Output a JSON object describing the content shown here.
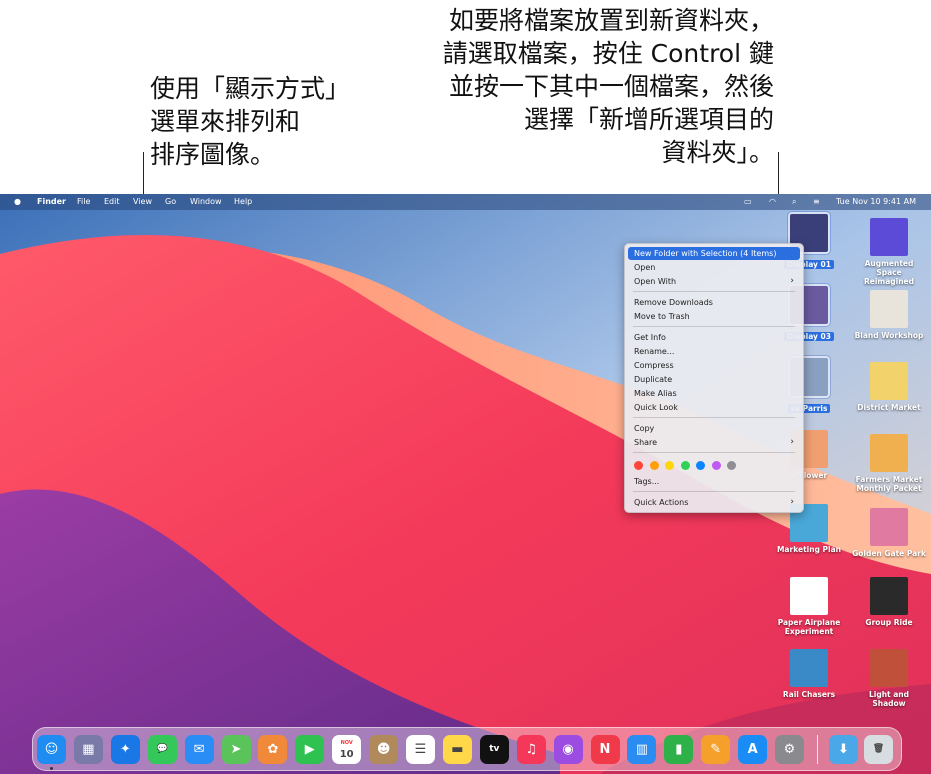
{
  "callouts": {
    "left": [
      "使用「顯示方式」",
      "選單來排列和",
      "排序圖像。"
    ],
    "right": [
      "如要將檔案放置到新資料夾，",
      "請選取檔案，按住 Control 鍵",
      "並按一下其中一個檔案，然後",
      "選擇「新增所選項目的",
      "資料夾」。"
    ]
  },
  "menubar": {
    "apple": "",
    "app_name": "Finder",
    "menus": [
      "File",
      "Edit",
      "View",
      "Go",
      "Window",
      "Help"
    ],
    "clock": "Tue Nov 10  9:41 AM",
    "status_icons": [
      "battery-icon",
      "wifi-icon",
      "spotlight-icon",
      "control-center-icon"
    ]
  },
  "context_menu": {
    "items": [
      {
        "label": "New Folder with Selection (4 Items)",
        "highlighted": true
      },
      {
        "label": "Open"
      },
      {
        "label": "Open With",
        "submenu": true
      },
      {
        "label": "Remove Downloads"
      },
      {
        "label": "Move to Trash"
      },
      {
        "label": "Get Info"
      },
      {
        "label": "Rename..."
      },
      {
        "label": "Compress"
      },
      {
        "label": "Duplicate"
      },
      {
        "label": "Make Alias"
      },
      {
        "label": "Quick Look"
      },
      {
        "label": "Copy"
      },
      {
        "label": "Share",
        "submenu": true
      },
      {
        "label": "Tags..."
      },
      {
        "label": "Quick Actions",
        "submenu": true
      }
    ],
    "tag_colors": [
      "#ff453a",
      "#ff9f0a",
      "#ffd60a",
      "#30d158",
      "#0a84ff",
      "#bf5af2",
      "#8e8e93"
    ],
    "submenu_chevron": "›"
  },
  "desktop_icons": [
    {
      "label": "Display 01",
      "selected": true,
      "color": "#3a3f7a"
    },
    {
      "label": "Augmented Space Reimagined",
      "color": "#5b4bd6"
    },
    {
      "label": "Display 03",
      "selected": true,
      "color": "#6a5aa0"
    },
    {
      "label": "Bland Workshop",
      "color": "#e8e4dc"
    },
    {
      "label": "sa Parris",
      "selected": true,
      "color": "#8aa0c0"
    },
    {
      "label": "District Market",
      "color": "#f2d36b"
    },
    {
      "label": "o Flower",
      "color": "#f0a070"
    },
    {
      "label": "Farmers Market Monthly Packet",
      "color": "#f0b050"
    },
    {
      "label": "Marketing Plan",
      "color": "#4aa8d8"
    },
    {
      "label": "Golden Gate Park",
      "color": "#e07aa0"
    },
    {
      "label": "Paper Airplane Experiment",
      "color": "#ffffff"
    },
    {
      "label": "Group Ride",
      "color": "#2a2a2a"
    },
    {
      "label": "Rail Chasers",
      "color": "#3a8ac8"
    },
    {
      "label": "Light and Shadow",
      "color": "#c0503a"
    }
  ],
  "dock": {
    "apps": [
      {
        "name": "finder-icon",
        "color": "#1e8cf0",
        "glyph": "☺"
      },
      {
        "name": "launchpad-icon",
        "color": "#7a7aa8",
        "glyph": "▦"
      },
      {
        "name": "safari-icon",
        "color": "#1a78e6",
        "glyph": "✦"
      },
      {
        "name": "messages-icon",
        "color": "#34c759",
        "glyph": "💬"
      },
      {
        "name": "mail-icon",
        "color": "#2a8cf5",
        "glyph": "✉"
      },
      {
        "name": "maps-icon",
        "color": "#5ac35a",
        "glyph": "➤"
      },
      {
        "name": "photos-icon",
        "color": "#f08a3a",
        "glyph": "✿"
      },
      {
        "name": "facetime-icon",
        "color": "#2fc250",
        "glyph": "▶"
      },
      {
        "name": "calendar-icon",
        "color": "#ffffff",
        "glyph": "10",
        "month": "NOV"
      },
      {
        "name": "contacts-icon",
        "color": "#b08a5a",
        "glyph": "☻"
      },
      {
        "name": "reminders-icon",
        "color": "#ffffff",
        "glyph": "☰"
      },
      {
        "name": "notes-icon",
        "color": "#ffd84a",
        "glyph": "▬"
      },
      {
        "name": "apple-tv-icon",
        "color": "#111111",
        "glyph": "tv"
      },
      {
        "name": "music-icon",
        "color": "#f5385a",
        "glyph": "♫"
      },
      {
        "name": "podcasts-icon",
        "color": "#9c4ce0",
        "glyph": "◉"
      },
      {
        "name": "news-icon",
        "color": "#f03a4a",
        "glyph": "N"
      },
      {
        "name": "keynote-icon",
        "color": "#2a8cf0",
        "glyph": "▥"
      },
      {
        "name": "numbers-icon",
        "color": "#2fb14a",
        "glyph": "▮"
      },
      {
        "name": "pages-icon",
        "color": "#f5a02a",
        "glyph": "✎"
      },
      {
        "name": "app-store-icon",
        "color": "#1a8cf5",
        "glyph": "A"
      },
      {
        "name": "system-preferences-icon",
        "color": "#8a8a8e",
        "glyph": "⚙"
      },
      {
        "name": "downloads-folder-icon",
        "color": "#4aa8e8",
        "glyph": "⬇"
      },
      {
        "name": "trash-icon",
        "color": "#d8dde2",
        "glyph": "🗑"
      }
    ]
  }
}
